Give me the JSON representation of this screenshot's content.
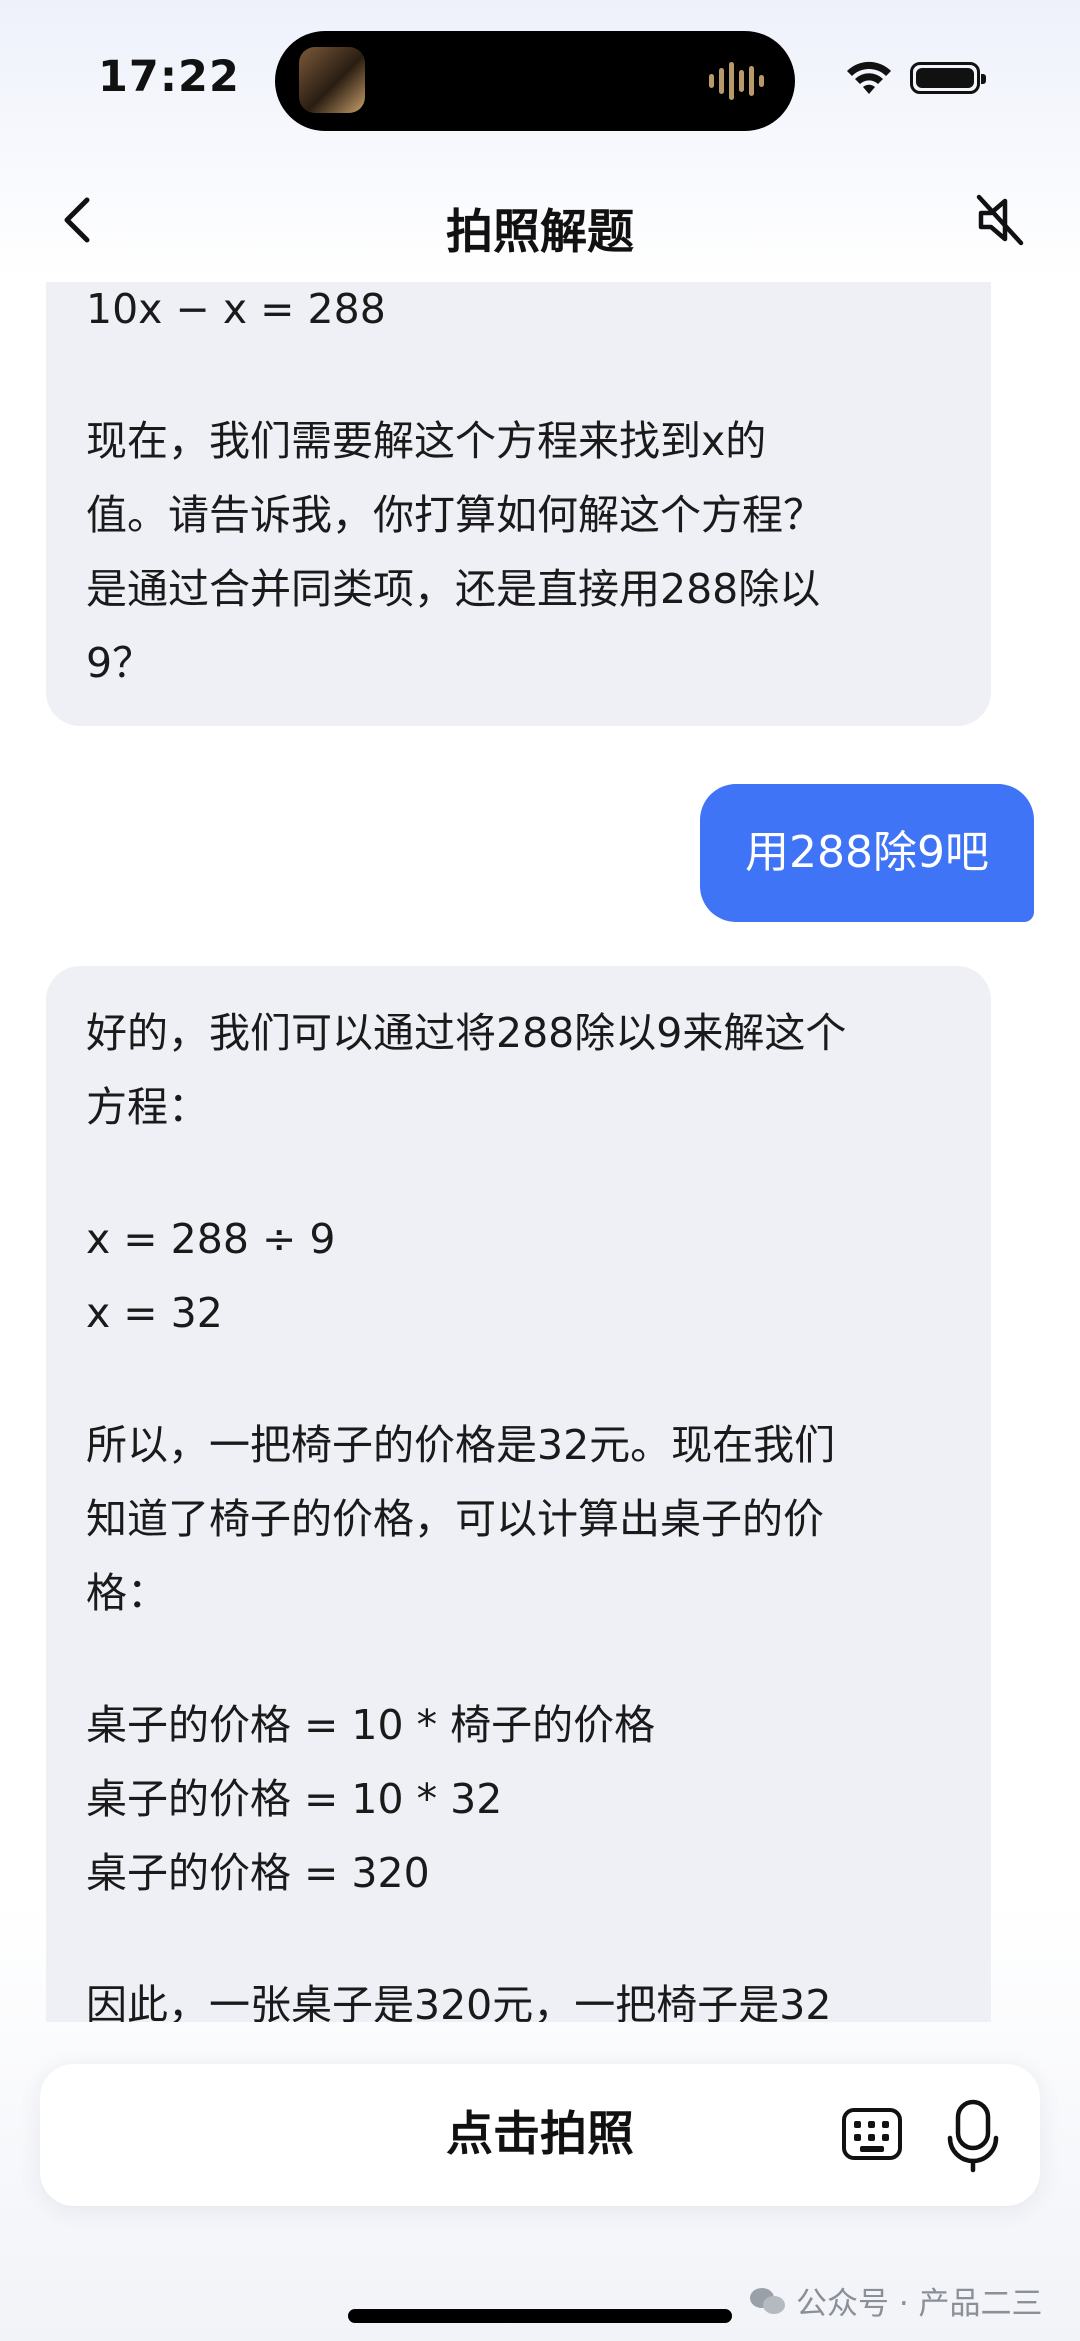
{
  "status": {
    "time": "17:22"
  },
  "header": {
    "title": "拍照解题"
  },
  "messages": {
    "ai_1": {
      "lines": [
        "10x − x = 288",
        "",
        "现在，我们需要解这个方程来找到x的",
        "值。请告诉我，你打算如何解这个方程？",
        "是通过合并同类项，还是直接用288除以",
        "9？"
      ]
    },
    "user_1": {
      "text": "用288除9吧"
    },
    "ai_2": {
      "lines": [
        "好的，我们可以通过将288除以9来解这个",
        "方程：",
        "",
        "x = 288 ÷ 9",
        "x = 32",
        "",
        "所以，一把椅子的价格是32元。现在我们",
        "知道了椅子的价格，可以计算出桌子的价",
        "格：",
        "",
        "桌子的价格 = 10 * 椅子的价格",
        "桌子的价格 = 10 * 32",
        "桌子的价格 = 320",
        "",
        "因此，一张桌子是320元，一把椅子是32"
      ]
    }
  },
  "bottom_bar": {
    "camera_label": "点击拍照"
  },
  "watermark": {
    "text": "公众号 · 产品二三"
  },
  "colors": {
    "user_bubble": "#3f74f7",
    "ai_bubble": "#eff0f6"
  },
  "icons": [
    "back-icon",
    "mute-icon",
    "wifi-icon",
    "battery-icon",
    "keyboard-icon",
    "mic-icon",
    "wechat-icon"
  ]
}
